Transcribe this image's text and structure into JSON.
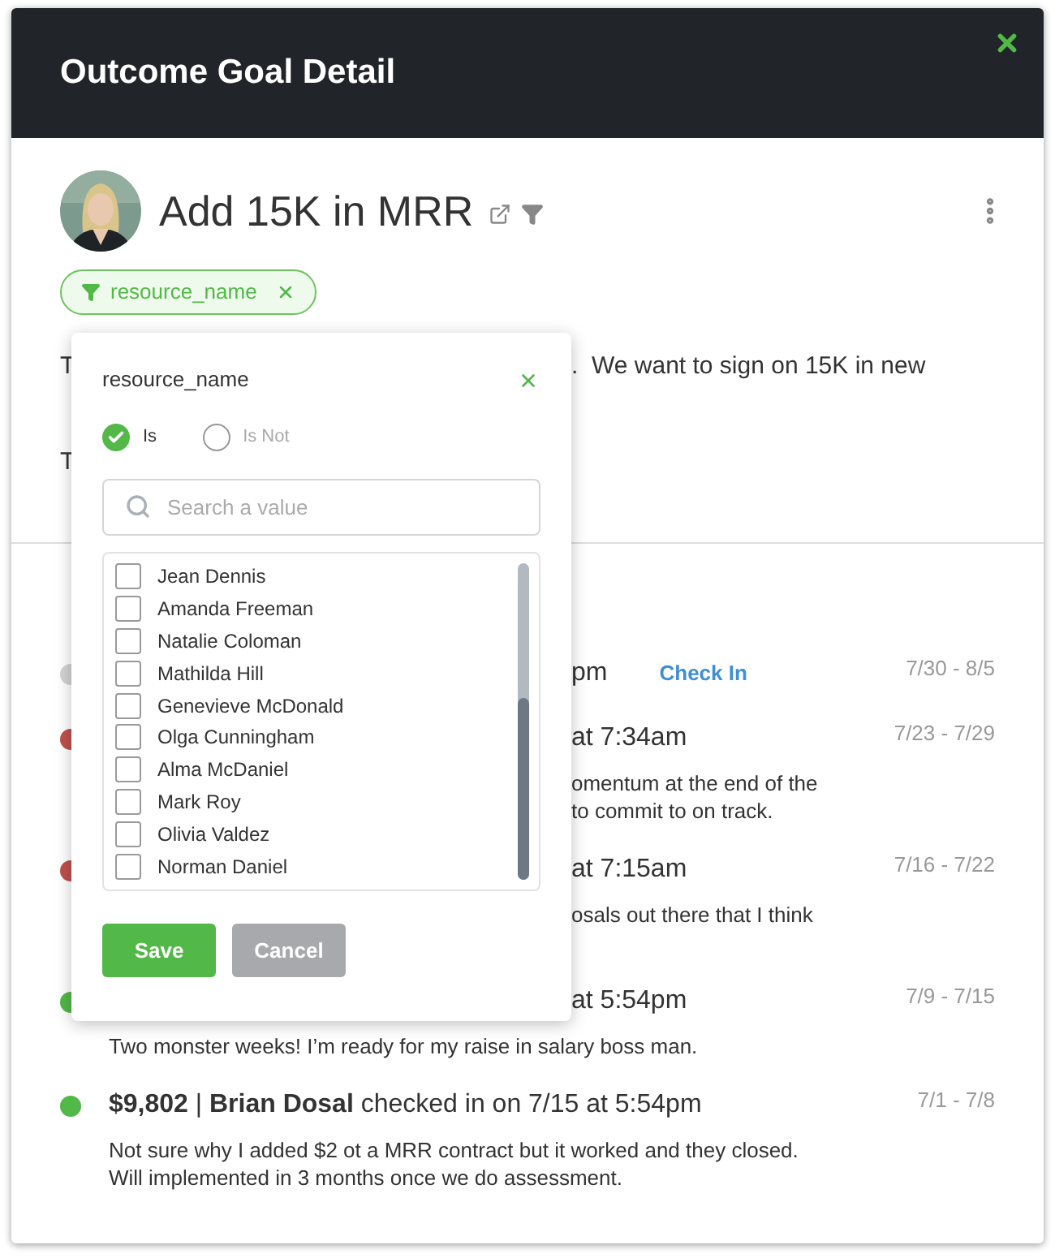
{
  "modal": {
    "title": "Outcome Goal Detail"
  },
  "goal": {
    "title": "Add 15K in MRR",
    "filter_chip": {
      "label": "resource_name"
    }
  },
  "description": [
    {
      "left": "T",
      "right": ".  We want to sign on 15K in new"
    },
    {
      "left": "T"
    }
  ],
  "checkins": [
    {
      "color": "#d3d3d3",
      "covered": true,
      "heading": "pm",
      "action": "Check In",
      "dates": "7/30 - 8/5"
    },
    {
      "color": "#c0504d",
      "covered": true,
      "heading": "at 7:34am",
      "dates": "7/23 - 7/29",
      "notes": [
        "omentum at the end of the",
        "to commit to on track."
      ],
      "notes_covered": true
    },
    {
      "color": "#c0504d",
      "covered": true,
      "heading": "at 7:15am",
      "dates": "7/16 - 7/22",
      "notes": [
        "osals out there that I think"
      ],
      "notes_covered": true
    },
    {
      "color": "#52b848",
      "covered": true,
      "heading": "at 5:54pm",
      "dates": "7/9 - 7/15",
      "notes": [
        "Two monster weeks!  I’m ready for my raise in salary boss man."
      ],
      "notes_covered": false
    },
    {
      "color": "#52b848",
      "covered": false,
      "heading": "**$9,802** | **Brian Dosal** checked in on 7/15 at 5:54pm",
      "dates": "7/1 - 7/8",
      "notes": [
        "Not sure why I added $2 ot a MRR contract but it worked and they closed.",
        "Will implemented in 3 months once we do assessment."
      ],
      "notes_covered": false
    }
  ],
  "filter_popover": {
    "title": "resource_name",
    "options": [
      {
        "label": "Is",
        "selected": true
      },
      {
        "label": "Is Not",
        "selected": false
      }
    ],
    "search": {
      "placeholder": "Search a value"
    },
    "values": [
      {
        "label": "Jean Dennis",
        "checked": false
      },
      {
        "label": "Amanda Freeman",
        "checked": false
      },
      {
        "label": "Natalie Coloman",
        "checked": false
      },
      {
        "label": "Mathilda Hill",
        "checked": false
      },
      {
        "label": "Genevieve McDonald",
        "checked": false
      },
      {
        "label": "Olga Cunningham",
        "checked": false
      },
      {
        "label": "Alma McDaniel",
        "checked": false
      },
      {
        "label": "Mark Roy",
        "checked": false
      },
      {
        "label": "Olivia Valdez",
        "checked": false
      },
      {
        "label": "Norman Daniel",
        "checked": false
      }
    ],
    "buttons": [
      {
        "label": "Save",
        "kind": "primary"
      },
      {
        "label": "Cancel",
        "kind": "secondary"
      }
    ]
  }
}
